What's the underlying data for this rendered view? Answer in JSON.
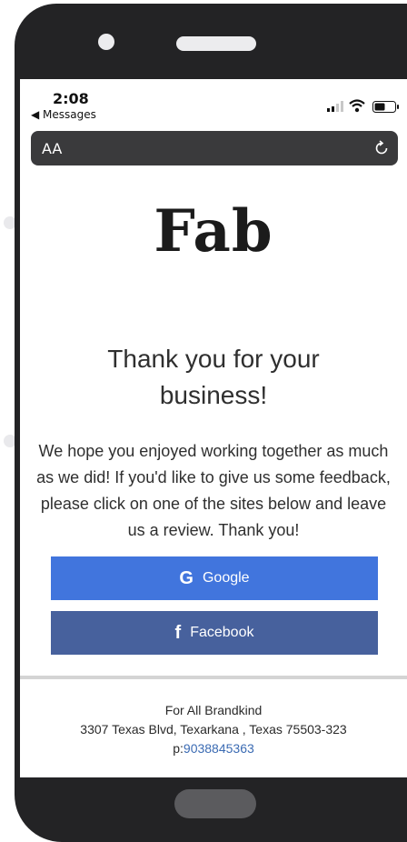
{
  "status_bar": {
    "time": "2:08",
    "back_label": "◀ Messages",
    "signal_icon": "signal-icon",
    "wifi_icon": "wifi-icon",
    "battery_icon": "battery-icon"
  },
  "address_bar": {
    "text_size_label": "AA",
    "reload_icon": "reload-icon"
  },
  "content": {
    "logo": "Fab",
    "heading": "Thank you for your business!",
    "message": "We hope you enjoyed working together as much as we did! If you'd like to give us some feedback, please click on one of the sites below and leave us a review. Thank you!",
    "buttons": [
      {
        "label": "Google",
        "icon": "G",
        "color": "#4175dd"
      },
      {
        "label": "Facebook",
        "icon": "f",
        "color": "#47619d"
      }
    ]
  },
  "footer": {
    "company": "For All Brandkind",
    "address": "3307 Texas Blvd, Texarkana , Texas 75503-323",
    "phone_prefix": "p:",
    "phone": "9038845363"
  }
}
